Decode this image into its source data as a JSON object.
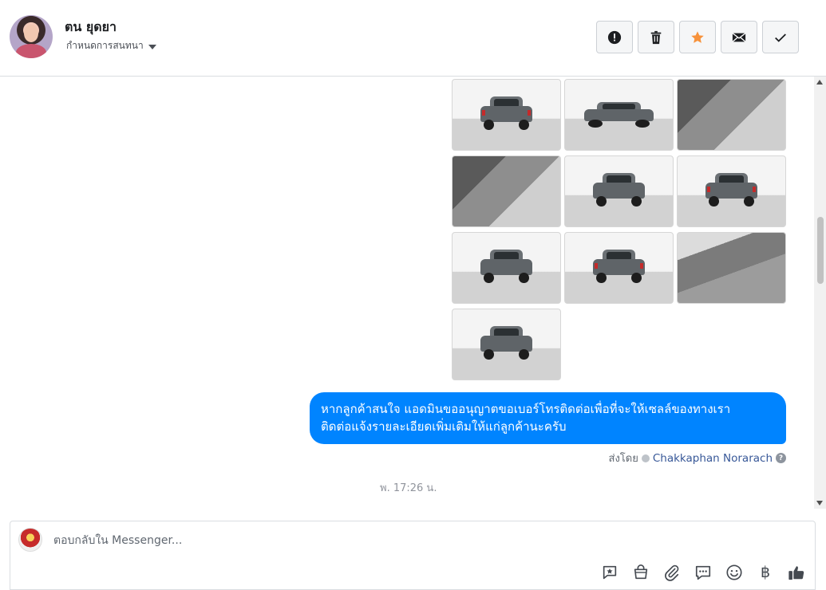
{
  "header": {
    "contact_name": "ตน ยุดยา",
    "conversation_settings_label": "กำหนดการสนทนา",
    "actions": [
      {
        "name": "report-button",
        "icon": "exclamation-icon"
      },
      {
        "name": "delete-button",
        "icon": "trash-icon"
      },
      {
        "name": "star-button",
        "icon": "star-icon",
        "color": "#f7923b"
      },
      {
        "name": "mark-unread-button",
        "icon": "envelope-icon"
      },
      {
        "name": "mark-done-button",
        "icon": "check-icon"
      }
    ]
  },
  "thread": {
    "photos": [
      {
        "kind": "truck-rear"
      },
      {
        "kind": "truck-side"
      },
      {
        "kind": "interior"
      },
      {
        "kind": "interior"
      },
      {
        "kind": "truck-front"
      },
      {
        "kind": "truck-rear"
      },
      {
        "kind": "truck-front"
      },
      {
        "kind": "truck-rear"
      },
      {
        "kind": "seat"
      },
      {
        "kind": "truck-front"
      }
    ],
    "message_line1": "หากลูกค้าสนใจ แอดมินขออนุญาตขอเบอร์โทรติดต่อเพื่อที่จะให้เซลล์ของทางเรา",
    "message_line2": "ติดต่อแจ้งรายละเอียดเพิ่มเติมให้แก่ลูกค้านะครับ",
    "bubble_color": "#0084ff",
    "sent_by_label": "ส่งโดย",
    "sender_name": "Chakkaphan Norarach",
    "help_glyph": "?",
    "timestamp": "พ. 17:26 น."
  },
  "composer": {
    "placeholder": "ตอบกลับใน Messenger...",
    "tools": [
      "saved-reply-icon",
      "shop-bag-icon",
      "paperclip-icon",
      "chat-bubble-icon",
      "emoji-icon",
      "baht-icon",
      "thumbs-up-icon"
    ],
    "baht_glyph": "฿"
  }
}
